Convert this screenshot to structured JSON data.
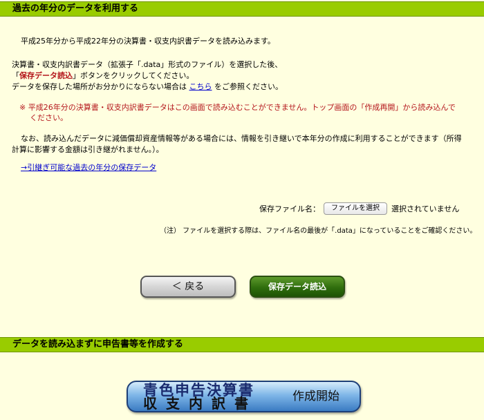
{
  "section1": {
    "title": "過去の年分のデータを利用する",
    "intro": "平成25年分から平成22年分の決算書・収支内訳書データを読み込みます。",
    "instruction_line1": "決算書・収支内訳書データ（拡張子「.data」形式のファイル）を選択した後、",
    "instruction_line2_open": "「",
    "instruction_button_name": "保存データ読込",
    "instruction_line2_close": "」ボタンをクリックしてください。",
    "instruction_line3_before": "データを保存した場所がお分かりにならない場合は",
    "instruction_link": "こちら",
    "instruction_line3_after": "をご参照ください。",
    "warning_line1": "※  平成26年分の決算書・収支内訳書データはこの画面で読み込むことができません。トップ画面の「作成再開」から読み込んで",
    "warning_line2": "ください。",
    "note_line1": "なお、読み込んだデータに減価償却資産情報等がある場合には、情報を引き継いで本年分の作成に利用することができます（所得",
    "note_line2": "計算に影響する金額は引き継がれません。）。",
    "inherit_link": "→引継ぎ可能な過去の年分の保存データ",
    "file_label": "保存ファイル名：",
    "file_button": "ファイルを選択",
    "file_status": "選択されていません",
    "file_note": "（注） ファイルを選択する際は、ファイル名の最後が「.data」になっていることをご確認ください。",
    "back_button": "＜  戻る",
    "load_button": "保存データ読込"
  },
  "section2": {
    "title": "データを読み込まずに申告書等を作成する",
    "button_line1": "青色申告決算書",
    "button_line2": "収支内訳書",
    "button_start": "作成開始"
  }
}
